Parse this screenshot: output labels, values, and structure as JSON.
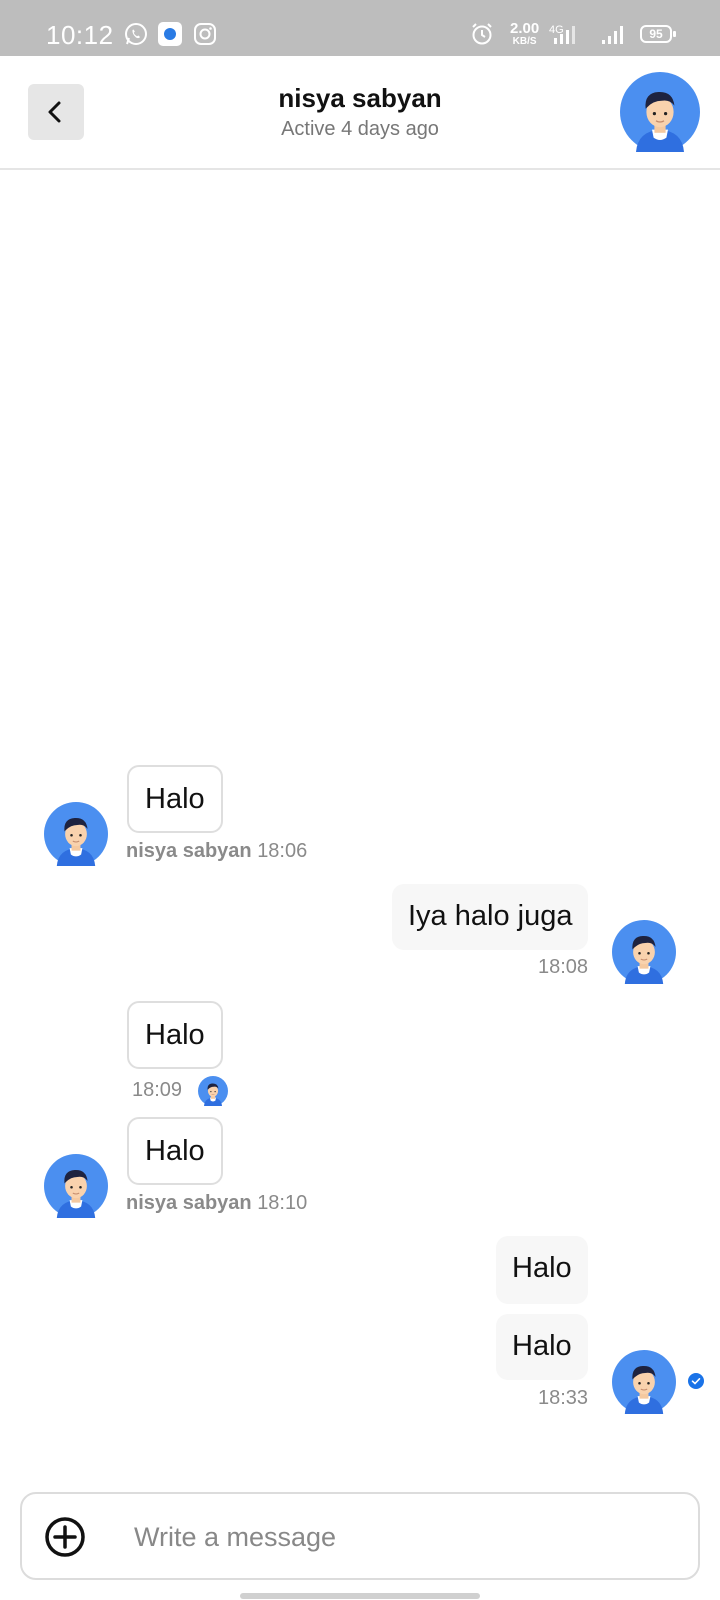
{
  "status_bar": {
    "time": "10:12",
    "net_speed_value": "2.00",
    "net_speed_unit": "KB/S",
    "network_type": "4G",
    "battery": "95",
    "icons": [
      "whatsapp-icon",
      "signal-app-icon",
      "instagram-icon",
      "alarm-icon",
      "signal-icon",
      "battery-icon"
    ]
  },
  "header": {
    "name": "nisya sabyan",
    "status": "Active 4 days ago"
  },
  "messages": [
    {
      "direction": "in",
      "text": "Halo",
      "sender": "nisya sabyan",
      "time": "18:06"
    },
    {
      "direction": "out",
      "text": "Iya halo juga",
      "time": "18:08"
    },
    {
      "direction": "in",
      "text": "Halo",
      "time": "18:09"
    },
    {
      "direction": "in",
      "text": "Halo",
      "sender": "nisya sabyan",
      "time": "18:10"
    },
    {
      "direction": "out",
      "text": "Halo"
    },
    {
      "direction": "out",
      "text": "Halo",
      "time": "18:33"
    }
  ],
  "composer": {
    "placeholder": "Write a message"
  },
  "colors": {
    "avatar_bg": "#4b8ff0",
    "status_bar_bg": "#bdbdbd",
    "read_check": "#1a73e8"
  }
}
